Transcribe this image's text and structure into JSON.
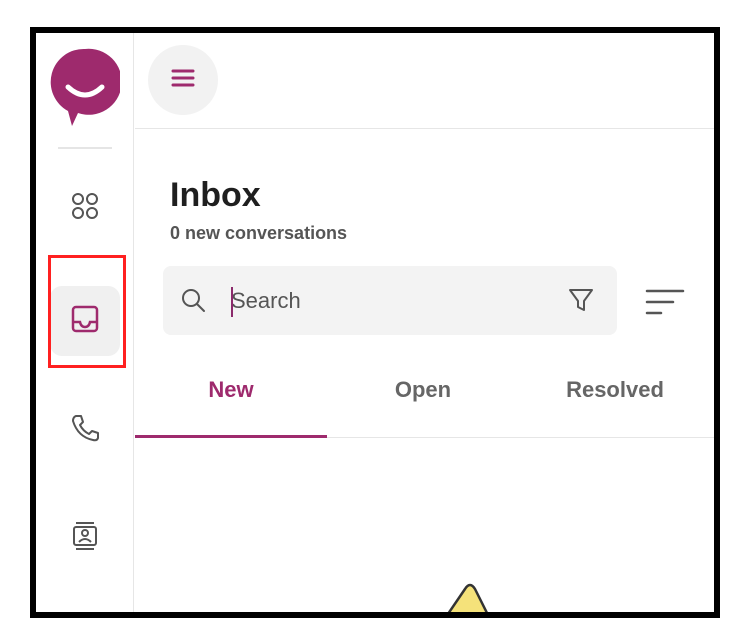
{
  "colors": {
    "brand": "#9e2a6d",
    "highlight_box": "#ff2020",
    "rail_active_bg": "#f0f0f0",
    "search_bg": "#f3f3f3",
    "illustration_yellow": "#f5e27a"
  },
  "rail": {
    "logo_icon": "smiley-chat-logo",
    "items": [
      {
        "name": "apps",
        "icon": "apps-grid-icon",
        "active": false
      },
      {
        "name": "inbox",
        "icon": "inbox-tray-icon",
        "active": true
      },
      {
        "name": "calls",
        "icon": "phone-icon",
        "active": false
      },
      {
        "name": "contacts",
        "icon": "contact-card-icon",
        "active": false
      }
    ]
  },
  "topbar": {
    "menu_icon": "hamburger-menu-icon"
  },
  "inbox": {
    "title": "Inbox",
    "subtitle": "0 new conversations"
  },
  "search": {
    "placeholder": "Search",
    "value": "",
    "icons": [
      "search-icon",
      "filter-funnel-icon",
      "sort-lines-icon"
    ]
  },
  "tabs": [
    {
      "label": "New",
      "active": true
    },
    {
      "label": "Open",
      "active": false
    },
    {
      "label": "Resolved",
      "active": false
    }
  ]
}
